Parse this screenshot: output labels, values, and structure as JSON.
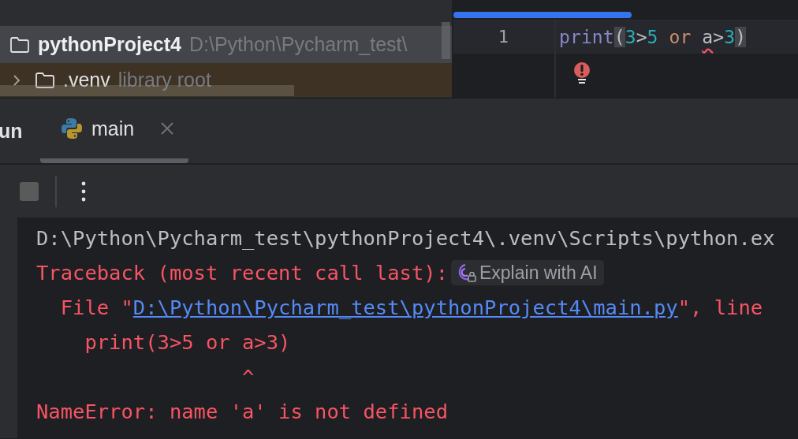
{
  "project_tree": {
    "items": [
      {
        "name": "pythonProject4",
        "path": "D:\\Python\\Pycharm_test\\",
        "selected": true,
        "library_root": false,
        "children": [
          {
            "name": ".venv",
            "hint": "library root",
            "selected": false,
            "expanded": false,
            "library_root": true
          }
        ]
      }
    ]
  },
  "editor": {
    "line_numbers": [
      "1"
    ],
    "lines": [
      {
        "tokens": [
          {
            "text": "print",
            "kind": "builtin"
          },
          {
            "text": "(",
            "kind": "paren",
            "matched": true
          },
          {
            "text": "3",
            "kind": "number"
          },
          {
            "text": ">",
            "kind": "op"
          },
          {
            "text": "5",
            "kind": "number"
          },
          {
            "text": " or ",
            "kind": "keyword"
          },
          {
            "text": "a",
            "kind": "name",
            "error": true
          },
          {
            "text": ">",
            "kind": "op"
          },
          {
            "text": "3",
            "kind": "number"
          },
          {
            "text": ")",
            "kind": "paren",
            "matched": true
          }
        ]
      }
    ]
  },
  "run_panel": {
    "title": "un",
    "tabs": [
      {
        "label": "main",
        "selected": true,
        "closable": true
      }
    ],
    "console": {
      "lines": [
        {
          "kind": "normal",
          "parts": [
            {
              "text": "D:\\Python\\Pycharm_test\\pythonProject4\\.venv\\Scripts\\python.ex",
              "link": false
            }
          ]
        },
        {
          "kind": "error",
          "parts": [
            {
              "text": "Traceback (most recent call last):",
              "link": false
            }
          ],
          "action": "Explain with AI"
        },
        {
          "kind": "error",
          "parts": [
            {
              "text": "  File \"",
              "link": false
            },
            {
              "text": "D:\\Python\\Pycharm_test\\pythonProject4\\main.py",
              "link": true
            },
            {
              "text": "\", line",
              "link": false
            }
          ]
        },
        {
          "kind": "error",
          "parts": [
            {
              "text": "    print(3>5 or a>3)",
              "link": false
            }
          ]
        },
        {
          "kind": "error",
          "parts": [
            {
              "text": "                 ^",
              "link": false
            }
          ]
        },
        {
          "kind": "error",
          "parts": [
            {
              "text": "NameError: name 'a' is not defined",
              "link": false
            }
          ]
        }
      ]
    }
  }
}
